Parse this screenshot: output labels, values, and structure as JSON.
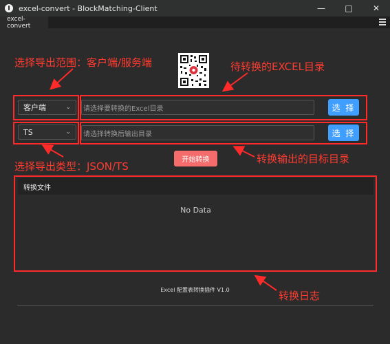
{
  "window": {
    "title": "excel-convert - BlockMatching-Client",
    "tab": "excel-convert"
  },
  "annotations": {
    "scope": "选择导出范围：客户端/服务端",
    "source_dir": "待转换的EXCEL目录",
    "type": "选择导出类型：JSON/TS",
    "output_dir": "转换输出的目标目录",
    "log": "转换日志"
  },
  "form": {
    "scope_value": "客户端",
    "type_value": "TS",
    "source_placeholder": "请选择要转换的Excel目录",
    "output_placeholder": "请选择转换后输出目录",
    "select_label": "选 择",
    "start_label": "开始转换"
  },
  "log": {
    "header": "转换文件",
    "empty": "No Data"
  },
  "footer": "Excel 配置表转换插件 V1.0",
  "colors": {
    "primary": "#409eff",
    "danger": "#f56c6c",
    "annotation": "#ff2a2a"
  },
  "icons": [
    "app-icon",
    "minimize-icon",
    "maximize-icon",
    "close-icon",
    "menu-icon",
    "chevron-down-icon",
    "qr-code"
  ]
}
